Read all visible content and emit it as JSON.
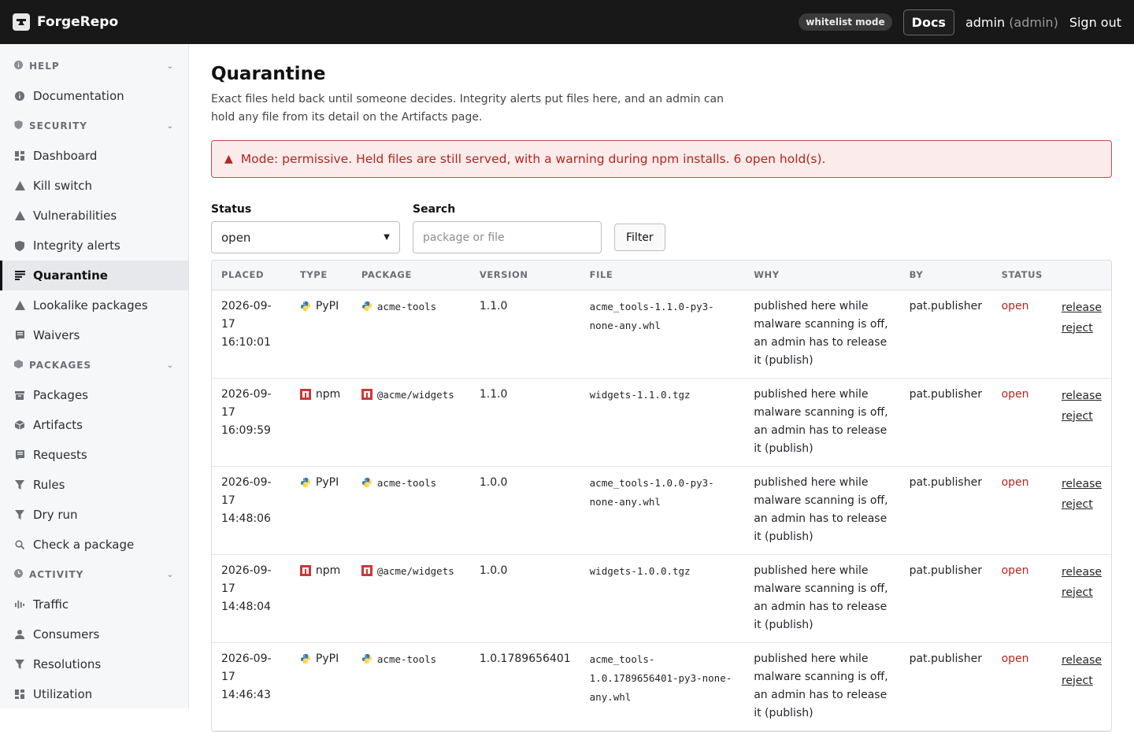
{
  "topbar": {
    "brand": "ForgeRepo",
    "mode_badge": "whitelist mode",
    "docs_label": "Docs",
    "user_name": "admin",
    "user_role": "(admin)",
    "signout_label": "Sign out"
  },
  "sidebar": {
    "sections": [
      {
        "title": "HELP",
        "items": [
          {
            "label": "Documentation",
            "icon": "info-icon"
          }
        ]
      },
      {
        "title": "SECURITY",
        "items": [
          {
            "label": "Dashboard",
            "icon": "grid-icon"
          },
          {
            "label": "Kill switch",
            "icon": "warning-icon"
          },
          {
            "label": "Vulnerabilities",
            "icon": "warning-icon"
          },
          {
            "label": "Integrity alerts",
            "icon": "shield-icon"
          },
          {
            "label": "Quarantine",
            "icon": "list-icon",
            "active": true
          },
          {
            "label": "Lookalike packages",
            "icon": "warning-icon"
          },
          {
            "label": "Waivers",
            "icon": "document-icon"
          }
        ]
      },
      {
        "title": "PACKAGES",
        "items": [
          {
            "label": "Packages",
            "icon": "box-icon"
          },
          {
            "label": "Artifacts",
            "icon": "cube-icon"
          },
          {
            "label": "Requests",
            "icon": "document-icon"
          },
          {
            "label": "Rules",
            "icon": "funnel-icon"
          },
          {
            "label": "Dry run",
            "icon": "funnel-icon"
          },
          {
            "label": "Check a package",
            "icon": "search-icon"
          }
        ]
      },
      {
        "title": "ACTIVITY",
        "items": [
          {
            "label": "Traffic",
            "icon": "bars-icon"
          },
          {
            "label": "Consumers",
            "icon": "person-icon"
          },
          {
            "label": "Resolutions",
            "icon": "funnel-icon"
          },
          {
            "label": "Utilization",
            "icon": "grid-icon"
          }
        ]
      }
    ]
  },
  "main": {
    "title": "Quarantine",
    "description": "Exact files held back until someone decides. Integrity alerts put files here, and an admin can hold any file from its detail on the Artifacts page.",
    "alert": "Mode: permissive. Held files are still served, with a warning during npm installs. 6 open hold(s).",
    "filters": {
      "status_label": "Status",
      "status_value": "open",
      "search_label": "Search",
      "search_placeholder": "package or file",
      "filter_button": "Filter"
    },
    "table": {
      "headers": [
        "PLACED",
        "TYPE",
        "PACKAGE",
        "VERSION",
        "FILE",
        "WHY",
        "BY",
        "STATUS",
        ""
      ],
      "rows": [
        {
          "placed": "2026-09-17 16:10:01",
          "type": "PyPI",
          "package": "acme-tools",
          "version": "1.1.0",
          "file": "acme_tools-1.1.0-py3-none-any.whl",
          "why": "published here while malware scanning is off, an admin has to release it (publish)",
          "by": "pat.publisher",
          "status": "open",
          "release": "release",
          "reject": "reject"
        },
        {
          "placed": "2026-09-17 16:09:59",
          "type": "npm",
          "package": "@acme/widgets",
          "version": "1.1.0",
          "file": "widgets-1.1.0.tgz",
          "why": "published here while malware scanning is off, an admin has to release it (publish)",
          "by": "pat.publisher",
          "status": "open",
          "release": "release",
          "reject": "reject"
        },
        {
          "placed": "2026-09-17 14:48:06",
          "type": "PyPI",
          "package": "acme-tools",
          "version": "1.0.0",
          "file": "acme_tools-1.0.0-py3-none-any.whl",
          "why": "published here while malware scanning is off, an admin has to release it (publish)",
          "by": "pat.publisher",
          "status": "open",
          "release": "release",
          "reject": "reject"
        },
        {
          "placed": "2026-09-17 14:48:04",
          "type": "npm",
          "package": "@acme/widgets",
          "version": "1.0.0",
          "file": "widgets-1.0.0.tgz",
          "why": "published here while malware scanning is off, an admin has to release it (publish)",
          "by": "pat.publisher",
          "status": "open",
          "release": "release",
          "reject": "reject"
        },
        {
          "placed": "2026-09-17 14:46:43",
          "type": "PyPI",
          "package": "acme-tools",
          "version": "1.0.1789656401",
          "file": "acme_tools-1.0.1789656401-py3-none-any.whl",
          "why": "published here while malware scanning is off, an admin has to release it (publish)",
          "by": "pat.publisher",
          "status": "open",
          "release": "release",
          "reject": "reject"
        }
      ]
    }
  },
  "colors": {
    "topbar_bg": "#181818",
    "alert_text": "#b3261e",
    "alert_bg": "#fcebeb",
    "status_open": "#b3261e",
    "npm_red": "#cb3837",
    "pypi_blue": "#3776ab",
    "pypi_yellow": "#ffd43b"
  }
}
